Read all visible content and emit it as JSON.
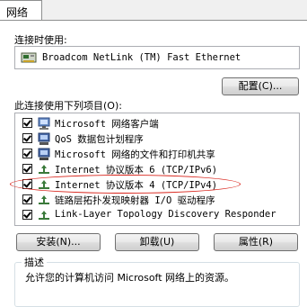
{
  "tabs": [
    {
      "label": "网络"
    }
  ],
  "connect_using": {
    "label": "连接时使用:",
    "adapter": "Broadcom NetLink (TM) Fast Ethernet",
    "configure_button": "配置(C)..."
  },
  "items_section": {
    "label": "此连接使用下列项目(O):",
    "items": [
      {
        "label": "Microsoft 网络客户端",
        "checked": true,
        "icon": "network-client-icon"
      },
      {
        "label": "QoS 数据包计划程序",
        "checked": true,
        "icon": "qos-scheduler-icon"
      },
      {
        "label": "Microsoft 网络的文件和打印机共享",
        "checked": true,
        "icon": "file-printer-sharing-icon"
      },
      {
        "label": "Internet 协议版本 6 (TCP/IPv6)",
        "checked": true,
        "icon": "protocol-icon"
      },
      {
        "label": "Internet 协议版本 4 (TCP/IPv4)",
        "checked": true,
        "icon": "protocol-icon",
        "highlighted": true
      },
      {
        "label": "链路层拓扑发现映射器 I/O 驱动程序",
        "checked": true,
        "icon": "protocol-icon"
      },
      {
        "label": "Link-Layer Topology Discovery Responder",
        "checked": true,
        "icon": "protocol-icon"
      }
    ]
  },
  "buttons": {
    "install": "安装(N)...",
    "uninstall": "卸载(U)",
    "properties": "属性(R)"
  },
  "description": {
    "label": "描述",
    "text": "允许您的计算机访问 Microsoft 网络上的资源。"
  },
  "colors": {
    "highlight_oval": "#d9251c",
    "border": "#abadb3"
  }
}
